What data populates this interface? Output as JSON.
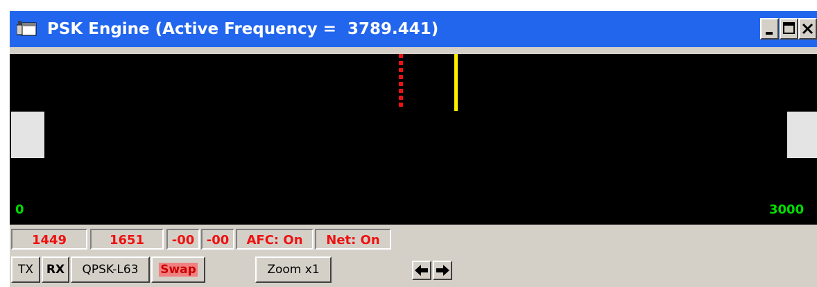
{
  "window": {
    "title": "PSK Engine (Active Frequency =  3789.441)",
    "controls": {
      "minimize": "_",
      "maximize": "□",
      "close": "×"
    }
  },
  "waterfall": {
    "axis_min_label": "0",
    "axis_max_label": "3000",
    "colors": {
      "rx_marker": "#ffee00",
      "tx_marker": "#ee1111",
      "axis": "#00dd00"
    }
  },
  "status": {
    "rx_freq": "1449",
    "tx_freq": "1651",
    "level1": "-00",
    "level2": "-00",
    "afc": "AFC: On",
    "net": "Net: On"
  },
  "buttons": {
    "tx": "TX",
    "rx": "RX",
    "mode": "QPSK-L63",
    "swap": "Swap",
    "zoom": "Zoom x1"
  },
  "icons": [
    "app-icon",
    "minimize-icon",
    "maximize-icon",
    "close-icon",
    "arrow-left-icon",
    "arrow-right-icon"
  ]
}
